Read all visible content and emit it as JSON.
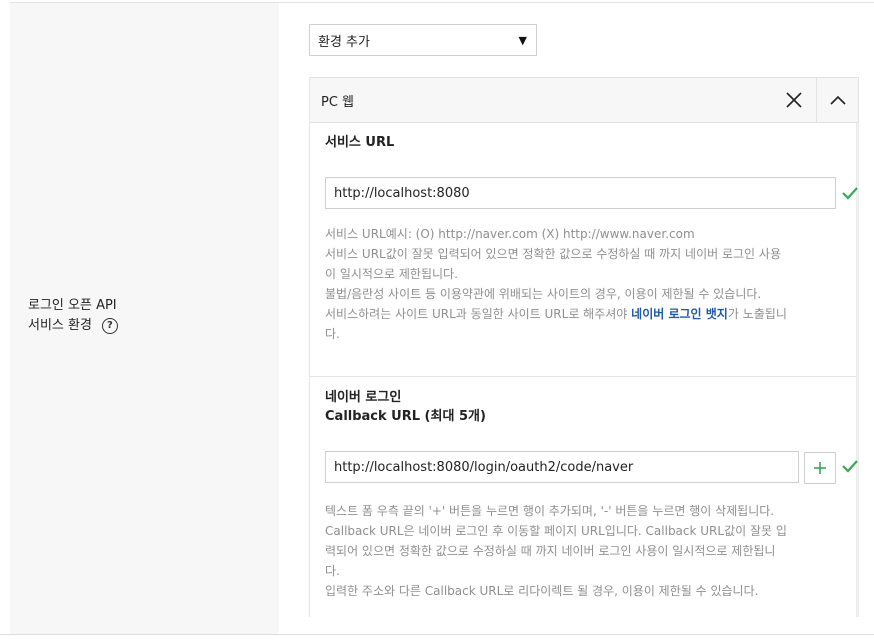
{
  "row": {
    "label_line1": "로그인 오픈 API",
    "label_line2": "서비스 환경",
    "help_glyph": "?"
  },
  "env_select": {
    "value": "환경 추가",
    "caret": "▼"
  },
  "panel": {
    "title": "PC 웹",
    "service_url": {
      "title": "서비스 URL",
      "value": "http://localhost:8080",
      "help_lines": [
        "서비스 URL예시: (O) http://naver.com (X) http://www.naver.com",
        "서비스 URL값이 잘못 입력되어 있으면 정확한 값으로 수정하실 때 까지 네이버 로그인 사용",
        "이 일시적으로 제한됩니다.",
        "불법/음란성 사이트 등 이용약관에 위배되는 사이트의 경우, 이용이 제한될 수 있습니다.",
        "서비스하려는 사이트 URL과 동일한 사이트 URL로 해주셔야 "
      ],
      "help_badge": "네이버 로그인 뱃지",
      "help_tail": "가 노출됩니",
      "help_tail2": "다."
    },
    "callback": {
      "title_line1": "네이버 로그인",
      "title_line2": "Callback URL (최대 5개)",
      "value": "http://localhost:8080/login/oauth2/code/naver",
      "add_glyph": "+",
      "help_lines": [
        "텍스트 폼 우측 끝의 '+' 버튼을 누르면 행이 추가되며, '-' 버튼을 누르면 행이 삭제됩니다.",
        "Callback URL은 네이버 로그인 후 이동할 페이지 URL입니다. Callback URL값이 잘못 입",
        "력되어 있으면 정확한 값으로 수정하실 때 까지 네이버 로그인 사용이 일시적으로 제한됩니",
        "다.",
        "입력한 주소와 다른 Callback URL로 리다이렉트 될 경우, 이용이 제한될 수 있습니다."
      ]
    }
  },
  "colors": {
    "check": "#3aa757",
    "link": "#1f5aa8",
    "help_text": "#8f8f8f"
  }
}
